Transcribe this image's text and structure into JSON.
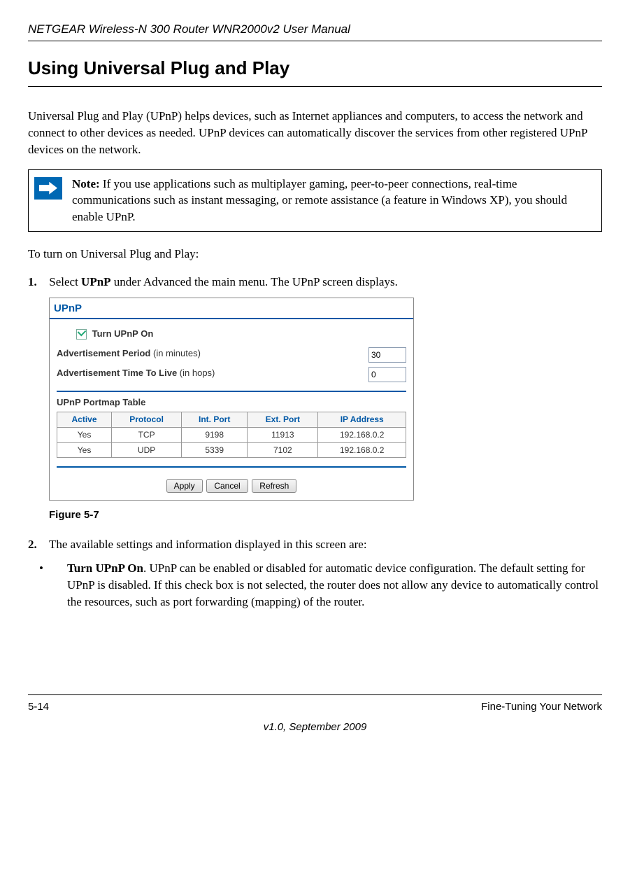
{
  "header": {
    "title": "NETGEAR Wireless-N 300 Router WNR2000v2 User Manual"
  },
  "section": {
    "heading": "Using Universal Plug and Play",
    "intro": "Universal Plug and Play (UPnP) helps devices, such as Internet appliances and computers, to access the network and connect to other devices as needed. UPnP devices can automatically discover the services from other registered UPnP devices on the network."
  },
  "note": {
    "label": "Note:",
    "text": " If you use applications such as multiplayer gaming, peer-to-peer connections, real-time communications such as instant messaging, or remote assistance (a feature in Windows XP), you should enable UPnP."
  },
  "procedure_intro": "To turn on Universal Plug and Play:",
  "step1": {
    "num": "1.",
    "pre": "Select ",
    "bold": "UPnP",
    "post": " under Advanced the main menu. The UPnP screen displays."
  },
  "upnp_screen": {
    "title": "UPnP",
    "checkbox_label": "Turn UPnP On",
    "adv_period_bold": "Advertisement Period",
    "adv_period_hint": " (in minutes)",
    "adv_period_value": "30",
    "adv_ttl_bold": "Advertisement Time To Live",
    "adv_ttl_hint": " (in hops)",
    "adv_ttl_value": "0",
    "portmap_label": "UPnP Portmap Table",
    "headers": {
      "active": "Active",
      "protocol": "Protocol",
      "intport": "Int. Port",
      "extport": "Ext. Port",
      "ip": "IP Address"
    },
    "row1": {
      "active": "Yes",
      "protocol": "TCP",
      "intport": "9198",
      "extport": "11913",
      "ip": "192.168.0.2"
    },
    "row2": {
      "active": "Yes",
      "protocol": "UDP",
      "intport": "5339",
      "extport": "7102",
      "ip": "192.168.0.2"
    },
    "buttons": {
      "apply": "Apply",
      "cancel": "Cancel",
      "refresh": "Refresh"
    }
  },
  "figure_label": "Figure 5-7",
  "step2": {
    "num": "2.",
    "text": "The available settings and information displayed in this screen are:"
  },
  "bullet1": {
    "dot": "•",
    "bold": "Turn UPnP On",
    "text": ". UPnP can be enabled or disabled for automatic device configuration. The default setting for UPnP is disabled. If this check box is not selected, the router does not allow any device to automatically control the resources, such as port forwarding (mapping) of the router."
  },
  "footer": {
    "page": "5-14",
    "chapter": "Fine-Tuning Your Network",
    "version": "v1.0, September 2009"
  }
}
